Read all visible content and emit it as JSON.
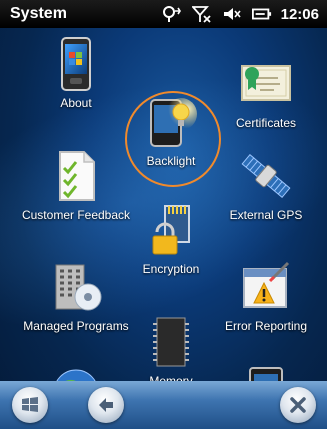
{
  "window": {
    "title": "System"
  },
  "status": {
    "time": "12:06"
  },
  "items": [
    {
      "label": "About"
    },
    {
      "label": "Certificates"
    },
    {
      "label": "Backlight"
    },
    {
      "label": "Customer Feedback"
    },
    {
      "label": "External GPS"
    },
    {
      "label": "Encryption"
    },
    {
      "label": "Managed Programs"
    },
    {
      "label": "Error Reporting"
    },
    {
      "label": "Memory"
    }
  ],
  "icons": {
    "about": "about-phone-icon",
    "certificates": "certificate-icon",
    "backlight": "backlight-icon",
    "customer_feedback": "checklist-icon",
    "external_gps": "satellite-icon",
    "encryption": "lock-card-icon",
    "managed_programs": "building-disc-icon",
    "error_reporting": "warning-window-icon",
    "memory": "memory-chip-icon",
    "globe": "globe-icon",
    "device": "device-icon",
    "start": "windows-start-icon",
    "back": "back-arrow-icon",
    "close": "close-icon"
  },
  "colors": {
    "highlight": "#f08a2c"
  }
}
